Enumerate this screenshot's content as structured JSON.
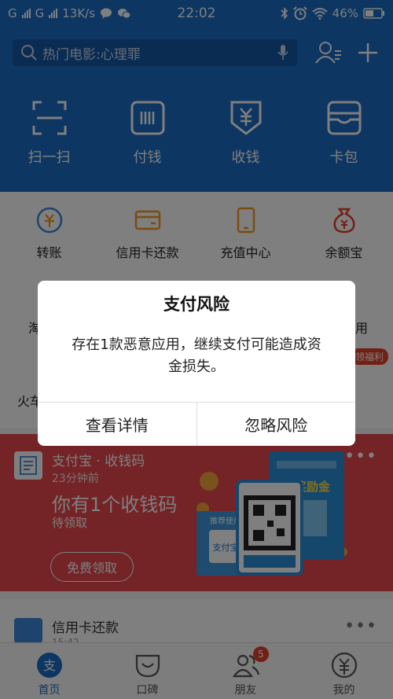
{
  "status_bar": {
    "carrier1": "G",
    "carrier2": "G",
    "speed": "13K/s",
    "time": "22:02",
    "battery": "46%"
  },
  "header": {
    "search_placeholder": "热门电影:心理罪",
    "quick_actions": [
      {
        "label": "扫一扫",
        "icon": "scan-icon"
      },
      {
        "label": "付钱",
        "icon": "pay-code-icon"
      },
      {
        "label": "收钱",
        "icon": "receive-money-icon"
      },
      {
        "label": "卡包",
        "icon": "card-wallet-icon"
      }
    ]
  },
  "grid": {
    "row1": [
      {
        "label": "转账",
        "icon": "transfer-icon"
      },
      {
        "label": "信用卡还款",
        "icon": "credit-card-icon"
      },
      {
        "label": "充值中心",
        "icon": "phone-recharge-icon"
      },
      {
        "label": "余额宝",
        "icon": "money-bag-icon"
      }
    ],
    "partial_left": "淘",
    "partial_right": "用",
    "partial_badge": "领福利",
    "partial_bottom": "火车"
  },
  "card": {
    "title": "支付宝 · 收钱码",
    "time": "23分钟前",
    "headline": "你有1个收钱码",
    "subtitle": "待领取",
    "button": "免费领取",
    "more": "•••",
    "poster_text": "得奖励金",
    "sign_text": "推荐使用",
    "sign_brand": "支付宝"
  },
  "card2": {
    "title": "信用卡还款",
    "sub": "15:42",
    "more": "•••"
  },
  "tabbar": [
    {
      "label": "首页",
      "icon": "home-alipay-icon"
    },
    {
      "label": "口碑",
      "icon": "koubei-icon"
    },
    {
      "label": "朋友",
      "icon": "friends-icon",
      "badge": "5"
    },
    {
      "label": "我的",
      "icon": "profile-yuan-icon"
    }
  ],
  "dialog": {
    "title": "支付风险",
    "message": "存在1款恶意应用，继续支付可能造成资金损失。",
    "view_details": "查看详情",
    "ignore_risk": "忽略风险"
  },
  "colors": {
    "brand_blue": "#1a6cc5",
    "card_red": "#e8484d",
    "badge_red": "#e5412a"
  }
}
